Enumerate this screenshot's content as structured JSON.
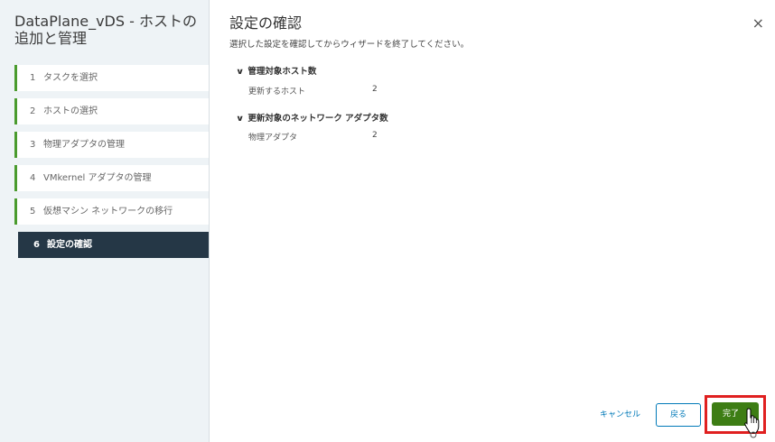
{
  "wizard": {
    "title": "DataPlane_vDS - ホストの追加と管理",
    "steps": [
      {
        "num": "1",
        "label": "タスクを選択"
      },
      {
        "num": "2",
        "label": "ホストの選択"
      },
      {
        "num": "3",
        "label": "物理アダプタの管理"
      },
      {
        "num": "4",
        "label": "VMkernel アダプタの管理"
      },
      {
        "num": "5",
        "label": "仮想マシン ネットワークの移行"
      },
      {
        "num": "6",
        "label": "設定の確認"
      }
    ],
    "active_step": 6
  },
  "page": {
    "title": "設定の確認",
    "description": "選択した設定を確認してからウィザードを終了してください。",
    "close_icon": "×"
  },
  "sections": [
    {
      "header": "管理対象ホスト数",
      "rows": [
        {
          "label": "更新するホスト",
          "value": "2"
        }
      ]
    },
    {
      "header": "更新対象のネットワーク アダプタ数",
      "rows": [
        {
          "label": "物理アダプタ",
          "value": "2"
        }
      ]
    }
  ],
  "footer": {
    "cancel_label": "キャンセル",
    "back_label": "戻る",
    "finish_label": "完了"
  },
  "colors": {
    "accent_green": "#3d7d14",
    "step_border": "#4a9b2e",
    "active_step_bg": "#253746",
    "link_blue": "#0079b8",
    "highlight_red": "#e02020"
  }
}
